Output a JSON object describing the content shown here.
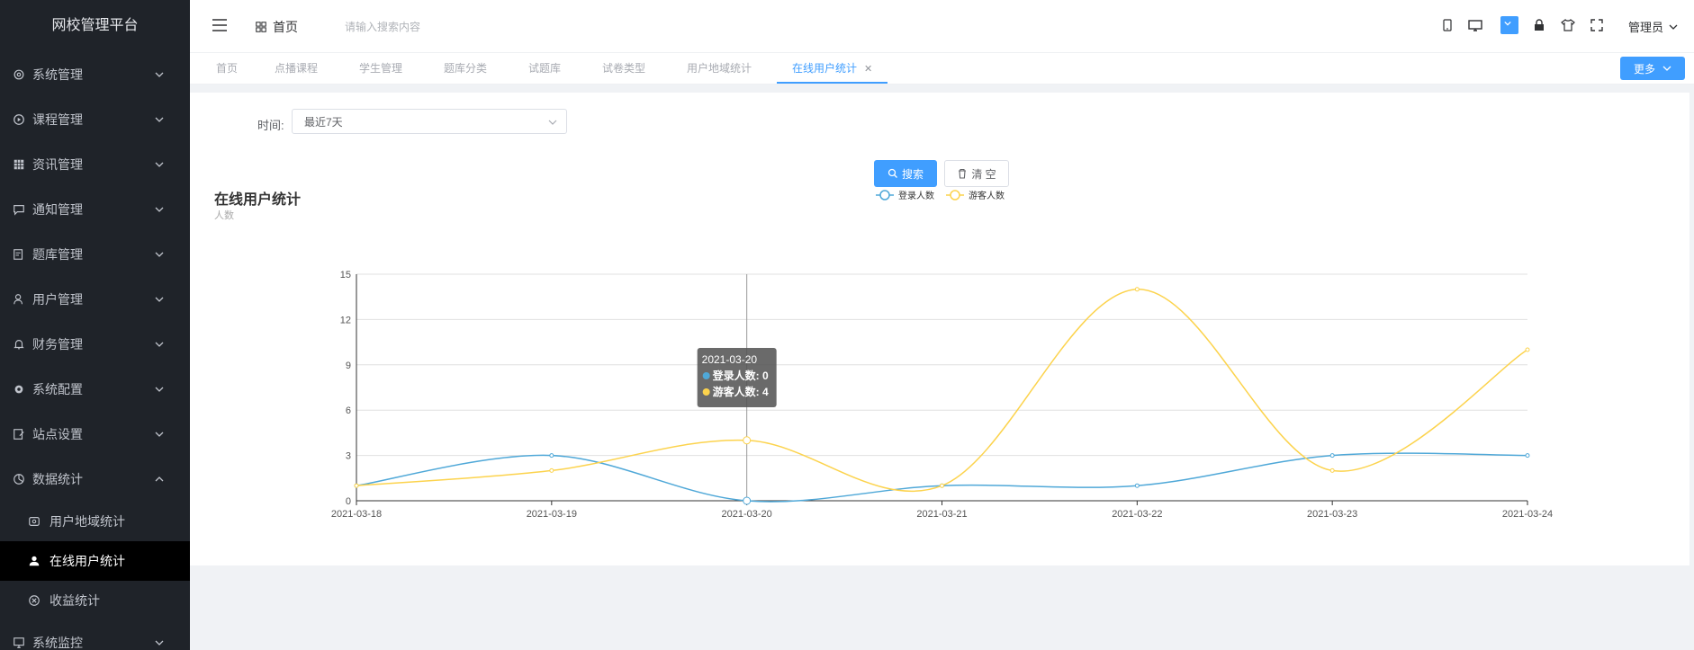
{
  "sidebar": {
    "brand": "网校管理平台",
    "items": [
      {
        "label": "系统管理",
        "icon": "gear-icon"
      },
      {
        "label": "课程管理",
        "icon": "play-circle-icon"
      },
      {
        "label": "资讯管理",
        "icon": "grid-icon"
      },
      {
        "label": "通知管理",
        "icon": "message-icon"
      },
      {
        "label": "题库管理",
        "icon": "edit-list-icon"
      },
      {
        "label": "用户管理",
        "icon": "user-gear-icon"
      },
      {
        "label": "财务管理",
        "icon": "bell-icon"
      },
      {
        "label": "系统配置",
        "icon": "gear-solid-icon"
      },
      {
        "label": "站点设置",
        "icon": "edit-doc-icon"
      },
      {
        "label": "数据统计",
        "icon": "pie-icon"
      }
    ],
    "sub_items": [
      {
        "label": "用户地域统计",
        "icon": "map-icon"
      },
      {
        "label": "在线用户统计",
        "icon": "user-icon"
      },
      {
        "label": "收益统计",
        "icon": "circle-x-icon"
      }
    ],
    "last_item": {
      "label": "系统监控",
      "icon": "monitor-icon"
    }
  },
  "header": {
    "home_label": "首页",
    "search_placeholder": "请输入搜索内容",
    "user_label": "管理员"
  },
  "tabs": [
    "首页",
    "点播课程",
    "学生管理",
    "题库分类",
    "试题库",
    "试卷类型",
    "用户地域统计",
    "在线用户统计"
  ],
  "more_button": "更多",
  "filter": {
    "time_label": "时间:",
    "time_value": "最近7天",
    "search_button": "搜索",
    "clear_button": "清 空"
  },
  "chart_data": {
    "type": "line",
    "title": "在线用户统计",
    "ylabel": "人数",
    "categories": [
      "2021-03-18",
      "2021-03-19",
      "2021-03-20",
      "2021-03-21",
      "2021-03-22",
      "2021-03-23",
      "2021-03-24"
    ],
    "series": [
      {
        "name": "登录人数",
        "values": [
          1,
          3,
          0,
          1,
          1,
          3,
          3
        ],
        "color": "#4fa8d8"
      },
      {
        "name": "游客人数",
        "values": [
          1,
          2,
          4,
          1,
          14,
          2,
          10
        ],
        "color": "#fcd34d"
      }
    ],
    "ylim": [
      0,
      15
    ],
    "yticks": [
      0,
      3,
      6,
      9,
      12,
      15
    ],
    "legend_position": "top-center",
    "grid": true,
    "tooltip": {
      "category": "2021-03-20",
      "lines": [
        "登录人数: 0",
        "游客人数: 4"
      ]
    }
  }
}
